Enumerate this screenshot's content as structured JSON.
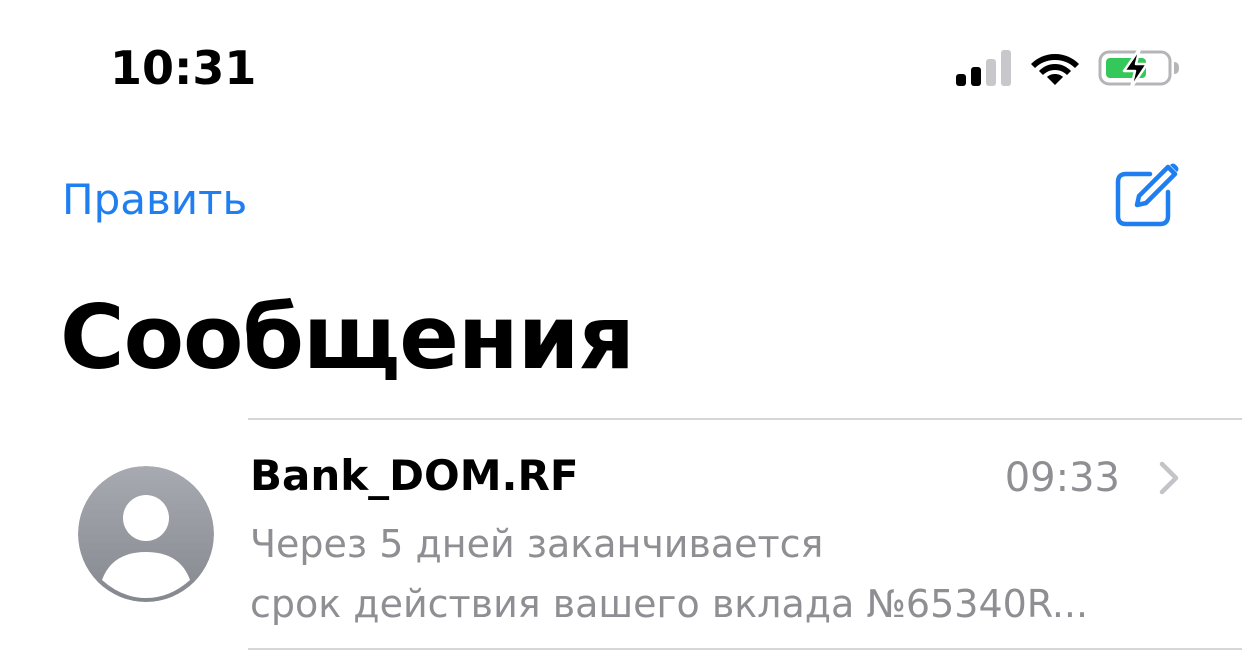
{
  "status_bar": {
    "time": "10:31",
    "icons": [
      "cellular-signal-icon",
      "wifi-icon",
      "battery-charging-icon"
    ]
  },
  "nav": {
    "edit_label": "Править",
    "compose_icon": "compose-icon"
  },
  "title": "Сообщения",
  "conversations": [
    {
      "sender": "Bank_DOM.RF",
      "time": "09:33",
      "preview_line1": "Через 5 дней заканчивается",
      "preview_line2": "срок действия вашего вклада №65340R..."
    }
  ],
  "colors": {
    "accent": "#1f7ef0",
    "secondary_text": "#8e8e93",
    "separator": "#d6d6d9",
    "battery_fill": "#34c759"
  }
}
